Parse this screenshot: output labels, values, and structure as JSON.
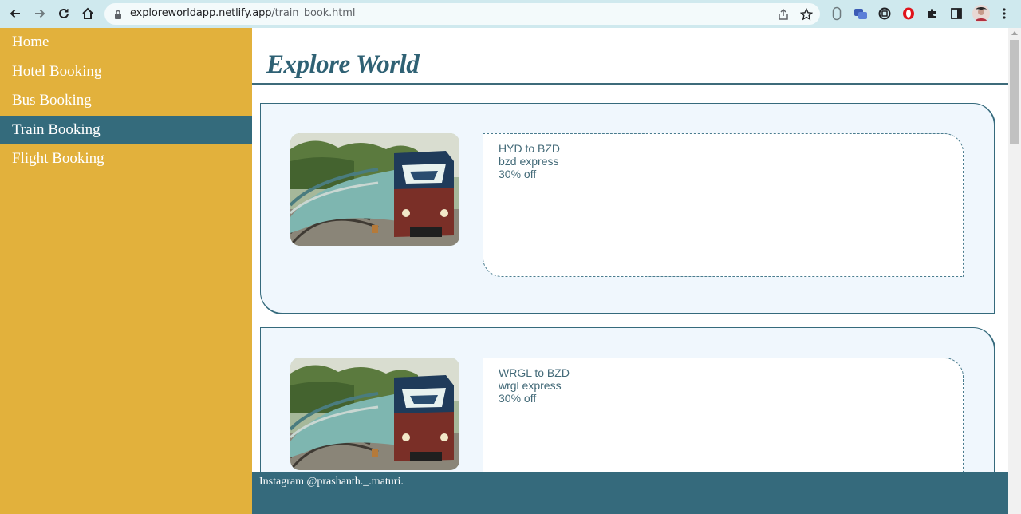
{
  "browser": {
    "url_host": "exploreworldapp.netlify.app",
    "url_path": "/train_book.html"
  },
  "sidebar": {
    "items": [
      {
        "label": "Home"
      },
      {
        "label": "Hotel Booking"
      },
      {
        "label": "Bus Booking"
      },
      {
        "label": "Train Booking",
        "active": true
      },
      {
        "label": "Flight Booking"
      }
    ]
  },
  "main": {
    "title": "Explore World",
    "cards": [
      {
        "route": "HYD to BZD",
        "train": "bzd express",
        "offer": "30% off"
      },
      {
        "route": "WRGL to BZD",
        "train": "wrgl express",
        "offer": "30% off"
      }
    ]
  },
  "footer": {
    "text": "Instagram @prashanth._.maturi."
  },
  "colors": {
    "sidebar_bg": "#e2b13c",
    "accent": "#346b7c",
    "card_bg": "#f0f7fd"
  }
}
